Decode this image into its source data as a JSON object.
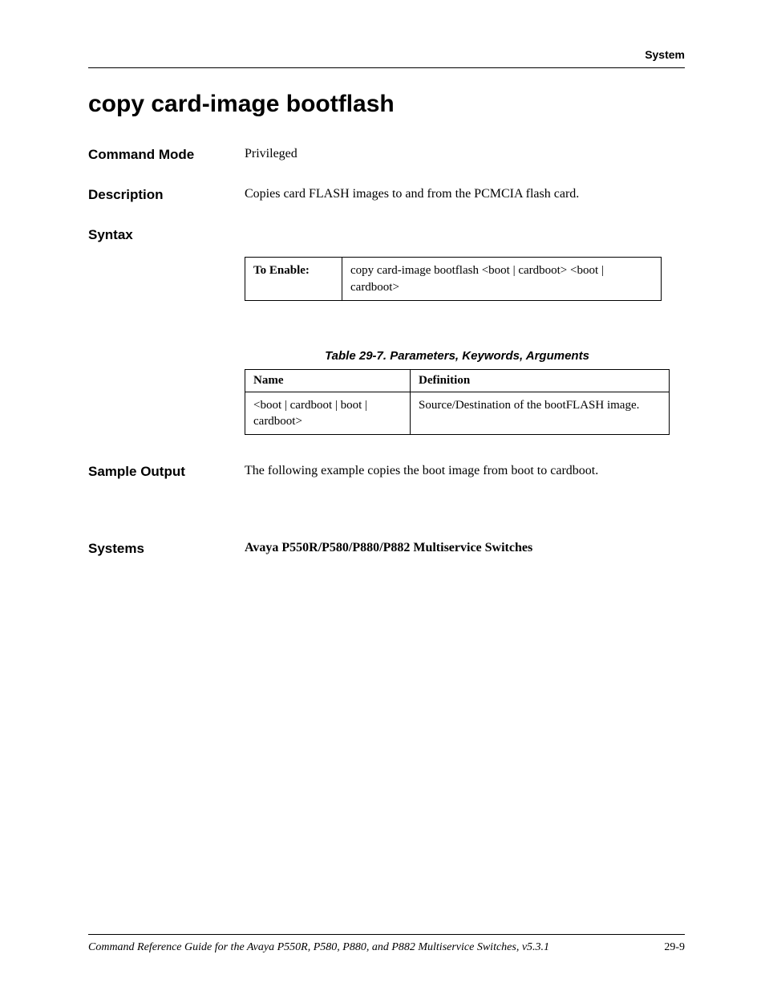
{
  "header": {
    "section": "System"
  },
  "title": "copy card-image bootflash",
  "command_mode": {
    "label": "Command Mode",
    "value": "Privileged"
  },
  "description": {
    "label": "Description",
    "value": "Copies card FLASH images to and from the PCMCIA flash card."
  },
  "syntax": {
    "label": "Syntax",
    "to_enable_label": "To Enable:",
    "to_enable_value": "copy card-image bootflash <boot | cardboot> <boot | cardboot>"
  },
  "param_table": {
    "caption": "Table 29-7.  Parameters, Keywords, Arguments",
    "headers": {
      "name": "Name",
      "definition": "Definition"
    },
    "rows": [
      {
        "name": "<boot | cardboot | boot | cardboot>",
        "definition": "Source/Destination of the bootFLASH image."
      }
    ]
  },
  "sample_output": {
    "label": "Sample Output",
    "value": "The following example copies the boot image from boot to cardboot."
  },
  "systems": {
    "label": "Systems",
    "value": "Avaya P550R/P580/P880/P882 Multiservice Switches"
  },
  "footer": {
    "text": "Command Reference Guide for the Avaya P550R, P580, P880, and P882 Multiservice Switches, v5.3.1",
    "page": "29-9"
  }
}
